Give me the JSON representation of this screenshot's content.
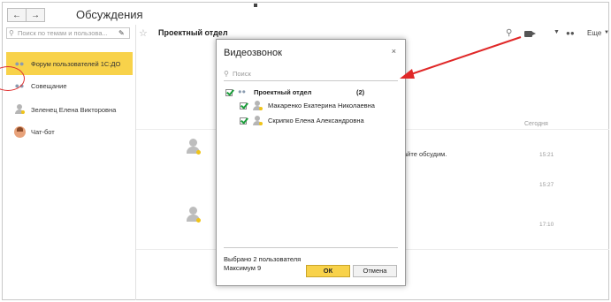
{
  "app": {
    "title": "Обсуждения"
  },
  "nav": {
    "back": "←",
    "forward": "→"
  },
  "left_search": {
    "placeholder": "Поиск по темам и пользова..."
  },
  "conversations": [
    {
      "label": "Форум пользователей 1С:ДО",
      "icon": "group-icon",
      "selected": true
    },
    {
      "label": "Совещание",
      "icon": "group-icon"
    },
    {
      "label": "Зеленец Елена Викторовна",
      "icon": "user-icon"
    },
    {
      "label": "Чат-бот",
      "icon": "bot-avatar-icon"
    }
  ],
  "chat": {
    "title": "Проектный отдел",
    "more_label": "Еще",
    "day_label": "Сегодня",
    "message_fragment": "айте обсудим.",
    "times": [
      "15:21",
      "15:27",
      "17:10"
    ]
  },
  "dialog": {
    "title": "Видеозвонок",
    "close": "×",
    "search_placeholder": "Поиск",
    "group": {
      "name": "Проектный отдел",
      "count": "(2)",
      "checked": true
    },
    "members": [
      {
        "name": "Макаренко Екатерина Николаевна",
        "checked": true
      },
      {
        "name": "Скрипко Елена Александровна",
        "checked": true
      }
    ],
    "selected_text": "Выбрано 2 пользователя",
    "max_text": "Максимум 9",
    "ok_label": "ОК",
    "cancel_label": "Отмена"
  },
  "colors": {
    "accent": "#f8d24a",
    "arrow": "#e02828",
    "check": "#1a9e3a"
  }
}
